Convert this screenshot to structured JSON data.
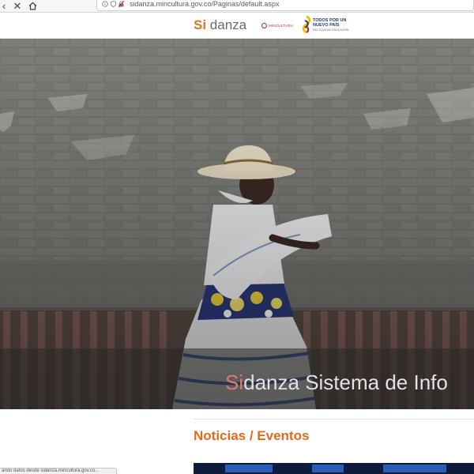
{
  "browser": {
    "url": "sidanza.mincultura.gov.co/Paginas/default.aspx",
    "icons": [
      "back-icon",
      "close-icon",
      "home-icon",
      "info-icon",
      "shield-icon",
      "lock-icon"
    ]
  },
  "header": {
    "logo_si": "Si",
    "logo_rest": " danza",
    "mincultura_label": "MINCULTURA",
    "gov_line1": "TODOS POR UN",
    "gov_line2": "NUEVO PAÍS",
    "gov_line3": "PAZ EQUIDAD EDUCACIÓN"
  },
  "hero": {
    "title_si": "Si",
    "title_rest": "danza Sistema de Info"
  },
  "news": {
    "section_title": "Noticias / Eventos"
  },
  "status_bar": {
    "text": "ando datos desde sidanza.mincultura.gov.co..."
  },
  "colors": {
    "accent_orange": "#e36a1c",
    "logo_gray": "#6b6b6b",
    "hero_si": "#e27a6c"
  }
}
